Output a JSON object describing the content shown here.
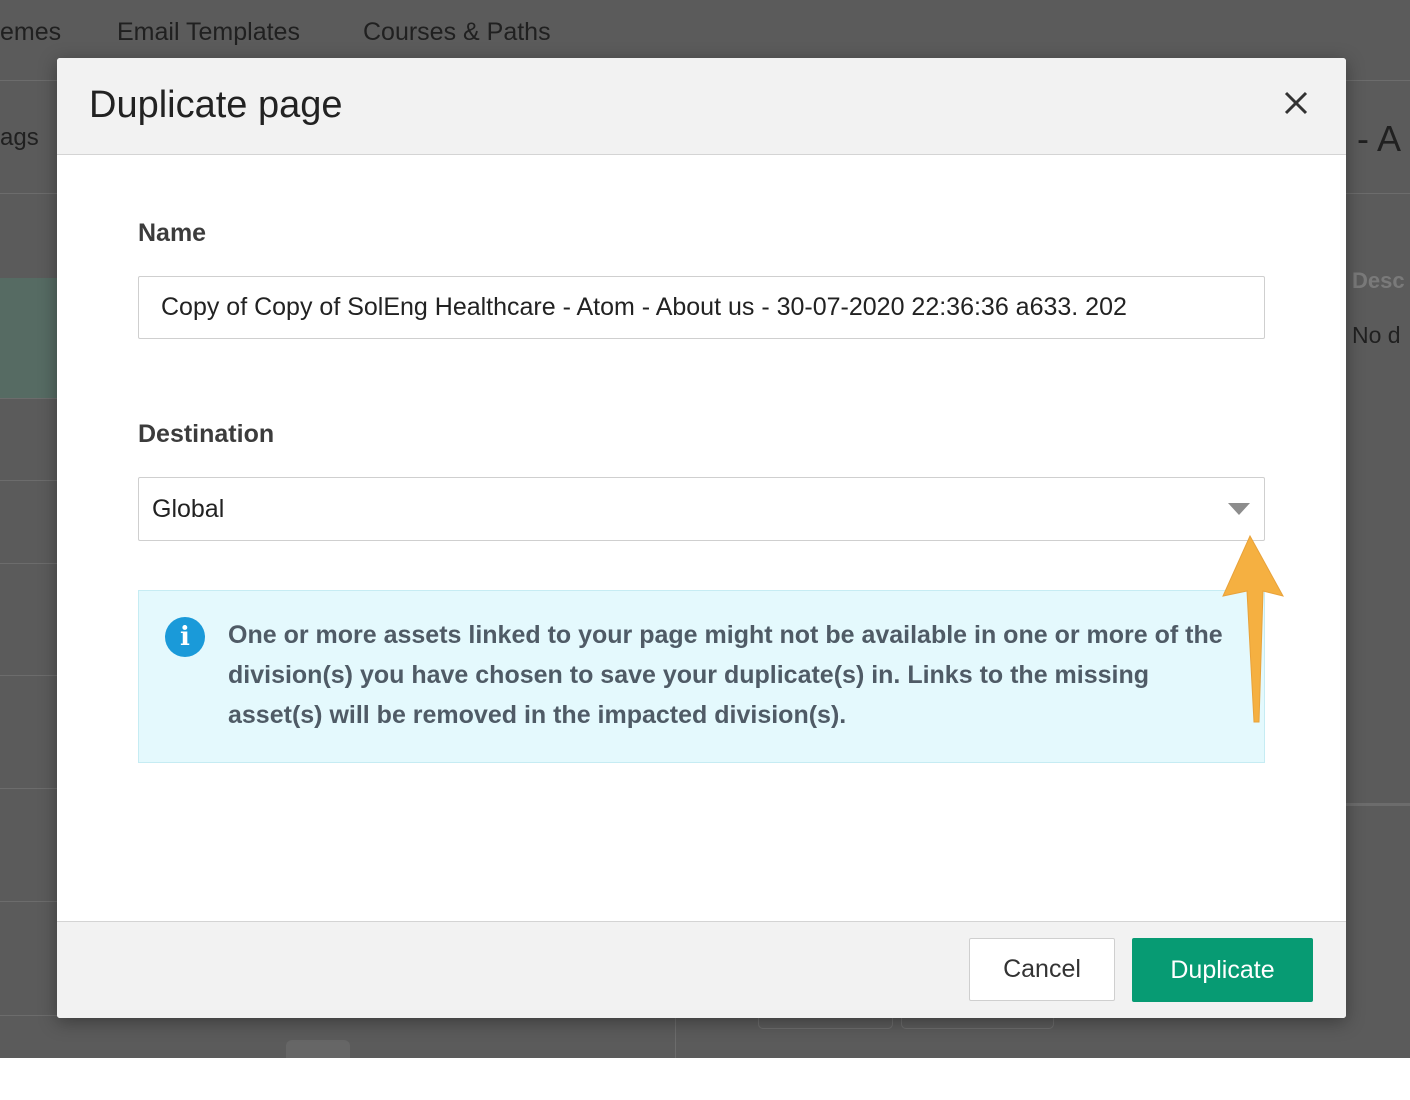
{
  "background": {
    "nav_items": [
      "emes",
      "Email Templates",
      "Courses & Paths"
    ],
    "tags_label": "ags",
    "right_title": "- A",
    "right_desc_label": "Desc",
    "right_desc_value": "No d"
  },
  "modal": {
    "title": "Duplicate page",
    "close_icon": "close-icon",
    "name_label": "Name",
    "name_value": "Copy of Copy of SolEng Healthcare - Atom - About us - 30-07-2020 22:36:36 a633. 202",
    "destination_label": "Destination",
    "destination_value": "Global",
    "info_icon": "info-icon",
    "info_text": "One or more assets linked to your page might not be available in one or more of the division(s) you have chosen to save your duplicate(s) in. Links to the missing asset(s) will be removed in the impacted division(s).",
    "cancel_label": "Cancel",
    "duplicate_label": "Duplicate"
  },
  "colors": {
    "overlay": "#5b5b5b",
    "primary": "#079b73",
    "info_bg": "#e4f9fd",
    "info_icon": "#1a9ad9",
    "annotation_arrow": "#f5b041"
  }
}
